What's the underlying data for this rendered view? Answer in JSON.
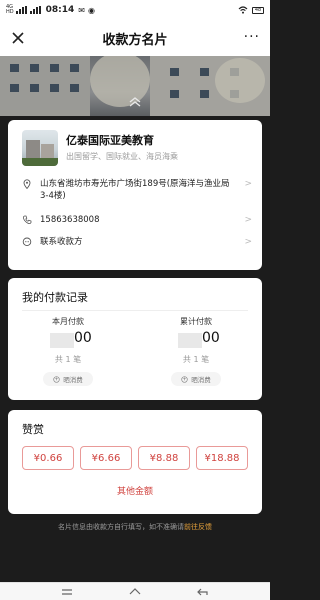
{
  "status_bar": {
    "network_top": "4G",
    "network_bottom": "HD",
    "time": "08:14",
    "battery": "48"
  },
  "nav": {
    "title": "收款方名片",
    "more": "···"
  },
  "profile": {
    "name": "亿泰国际亚美教育",
    "tags": "出国留学、国际就业、海员海乘",
    "address": "山东省潍坊市寿光市广场街189号(原海洋与渔业局3-4楼)",
    "phone": "15863638008",
    "contact_label": "联系收款方"
  },
  "records": {
    "title": "我的付款记录",
    "monthly": {
      "label": "本月付款",
      "amount_visible": "00",
      "count": "共 1 笔",
      "badge": "晒消费"
    },
    "total": {
      "label": "累计付款",
      "amount_visible": "00",
      "count": "共 1 笔",
      "badge": "晒消费"
    }
  },
  "reward": {
    "title": "赞赏",
    "options": [
      "¥0.66",
      "¥6.66",
      "¥8.88",
      "¥18.88"
    ],
    "other": "其他金额"
  },
  "footer": {
    "note": "名片信息由收款方自行填写，如不准确请",
    "link": "前往反馈"
  },
  "colors": {
    "accent_red": "#d0433f",
    "link_orange": "#e6a23c"
  }
}
